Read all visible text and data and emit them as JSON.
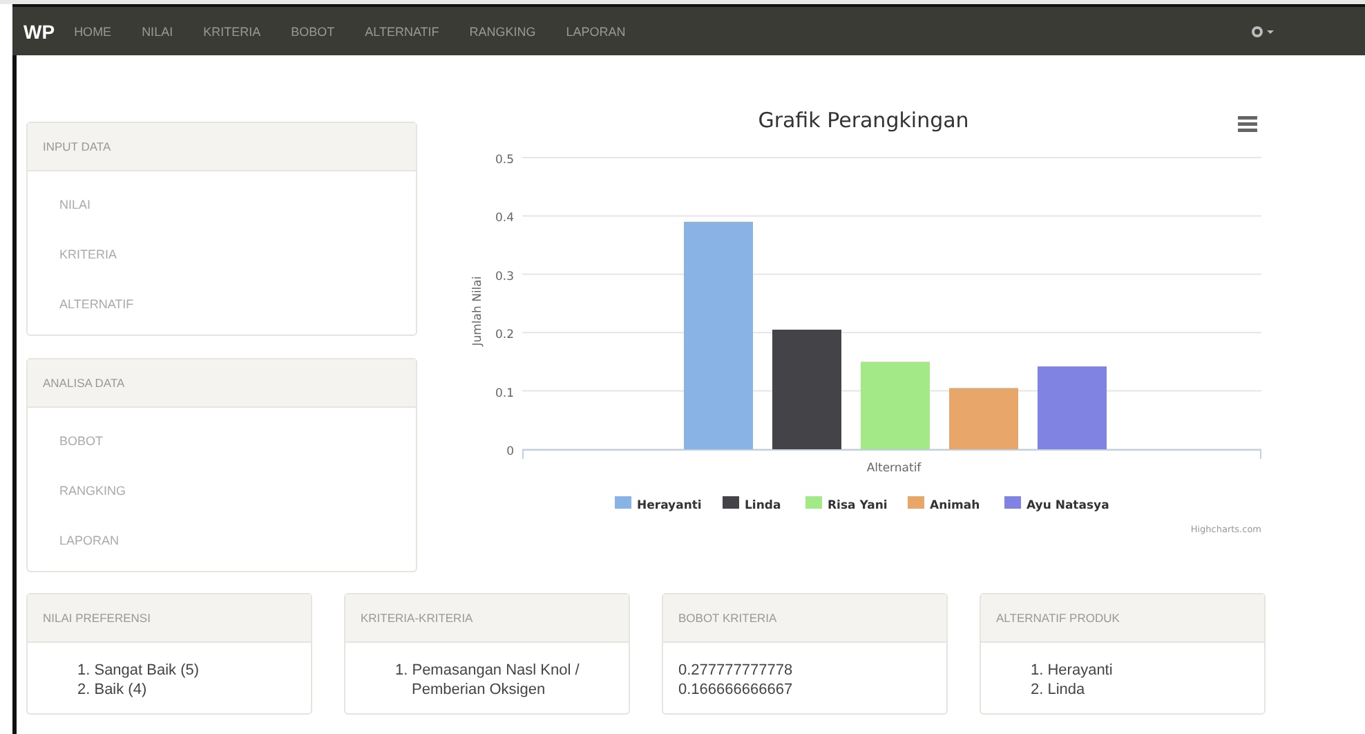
{
  "navbar": {
    "brand": "WP",
    "items": [
      "HOME",
      "NILAI",
      "KRITERIA",
      "BOBOT",
      "ALTERNATIF",
      "RANGKING",
      "LAPORAN"
    ]
  },
  "side_panels": [
    {
      "title": "INPUT DATA",
      "items": [
        "NILAI",
        "KRITERIA",
        "ALTERNATIF"
      ]
    },
    {
      "title": "ANALISA DATA",
      "items": [
        "BOBOT",
        "RANGKING",
        "LAPORAN"
      ]
    }
  ],
  "chart": {
    "chart_data": {
      "type": "bar",
      "title": "Grafik Perangkingan",
      "ylabel": "Jumlah Nilai",
      "categories": [
        "Alternatif"
      ],
      "ylim": [
        0,
        0.5
      ],
      "grid": true,
      "legend": true,
      "yticks": [
        0,
        0.1,
        0.2,
        0.3,
        0.4,
        0.5
      ],
      "series": [
        {
          "name": "Herayanti",
          "color": "#8ab3e5",
          "values": [
            0.39
          ]
        },
        {
          "name": "Linda",
          "color": "#434348",
          "values": [
            0.205
          ]
        },
        {
          "name": "Risa Yani",
          "color": "#a4e987",
          "values": [
            0.15
          ]
        },
        {
          "name": "Animah",
          "color": "#e8a66a",
          "values": [
            0.105
          ]
        },
        {
          "name": "Ayu Natasya",
          "color": "#8183e2",
          "values": [
            0.142
          ]
        }
      ]
    },
    "credit": "Highcharts.com"
  },
  "bottom_panels": [
    {
      "title": "NILAI PREFERENSI",
      "items": [
        "1. Sangat Baik (5)",
        "2. Baik (4)"
      ]
    },
    {
      "title": "KRITERIA-KRITERIA",
      "items": [
        "1. Pemasangan Nasl Knol / Pemberian Oksigen"
      ]
    },
    {
      "title": "BOBOT KRITERIA",
      "items": [
        "0.277777777778",
        "0.166666666667"
      ]
    },
    {
      "title": "ALTERNATIF PRODUK",
      "items": [
        "1. Herayanti",
        "2. Linda"
      ]
    }
  ]
}
